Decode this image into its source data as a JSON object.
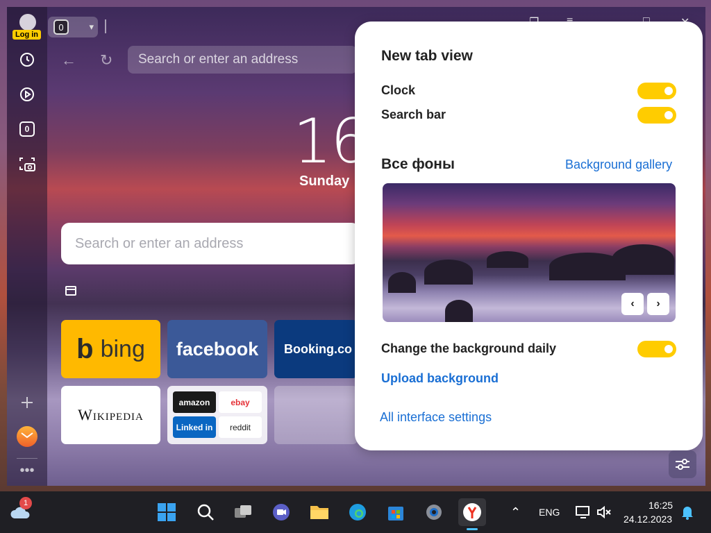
{
  "sidebar": {
    "login_label": "Log in",
    "tab_count": "0",
    "items": [
      "history-icon",
      "play-icon",
      "tab-counter",
      "screenshot-icon",
      "add-icon",
      "mail-icon",
      "more-icon"
    ],
    "counter_label": "0"
  },
  "toolbar": {
    "address_placeholder": "Search or enter an address"
  },
  "newtab": {
    "clock_partial": "16",
    "date_partial": "Sunday",
    "search_placeholder": "Search or enter an address",
    "tiles": {
      "bing": "bing",
      "facebook": "facebook",
      "booking": "Booking.co",
      "wikipedia": "Wikipedia",
      "amazon": "amazon",
      "ebay": "ebay",
      "linkedin": "Linked in",
      "reddit": "reddit"
    }
  },
  "panel": {
    "title": "New tab view",
    "clock_label": "Clock",
    "clock_on": true,
    "searchbar_label": "Search bar",
    "searchbar_on": true,
    "backgrounds_heading": "Все фоны",
    "gallery_link": "Background gallery",
    "change_daily_label": "Change the background daily",
    "change_daily_on": true,
    "upload_link": "Upload background",
    "all_settings_link": "All interface settings"
  },
  "taskbar": {
    "weather_badge": "1",
    "lang": "ENG",
    "time": "16:25",
    "date": "24.12.2023"
  },
  "colors": {
    "accent_yellow": "#ffcc00",
    "link_blue": "#1a6fd4",
    "taskbar": "#1f1f24"
  }
}
